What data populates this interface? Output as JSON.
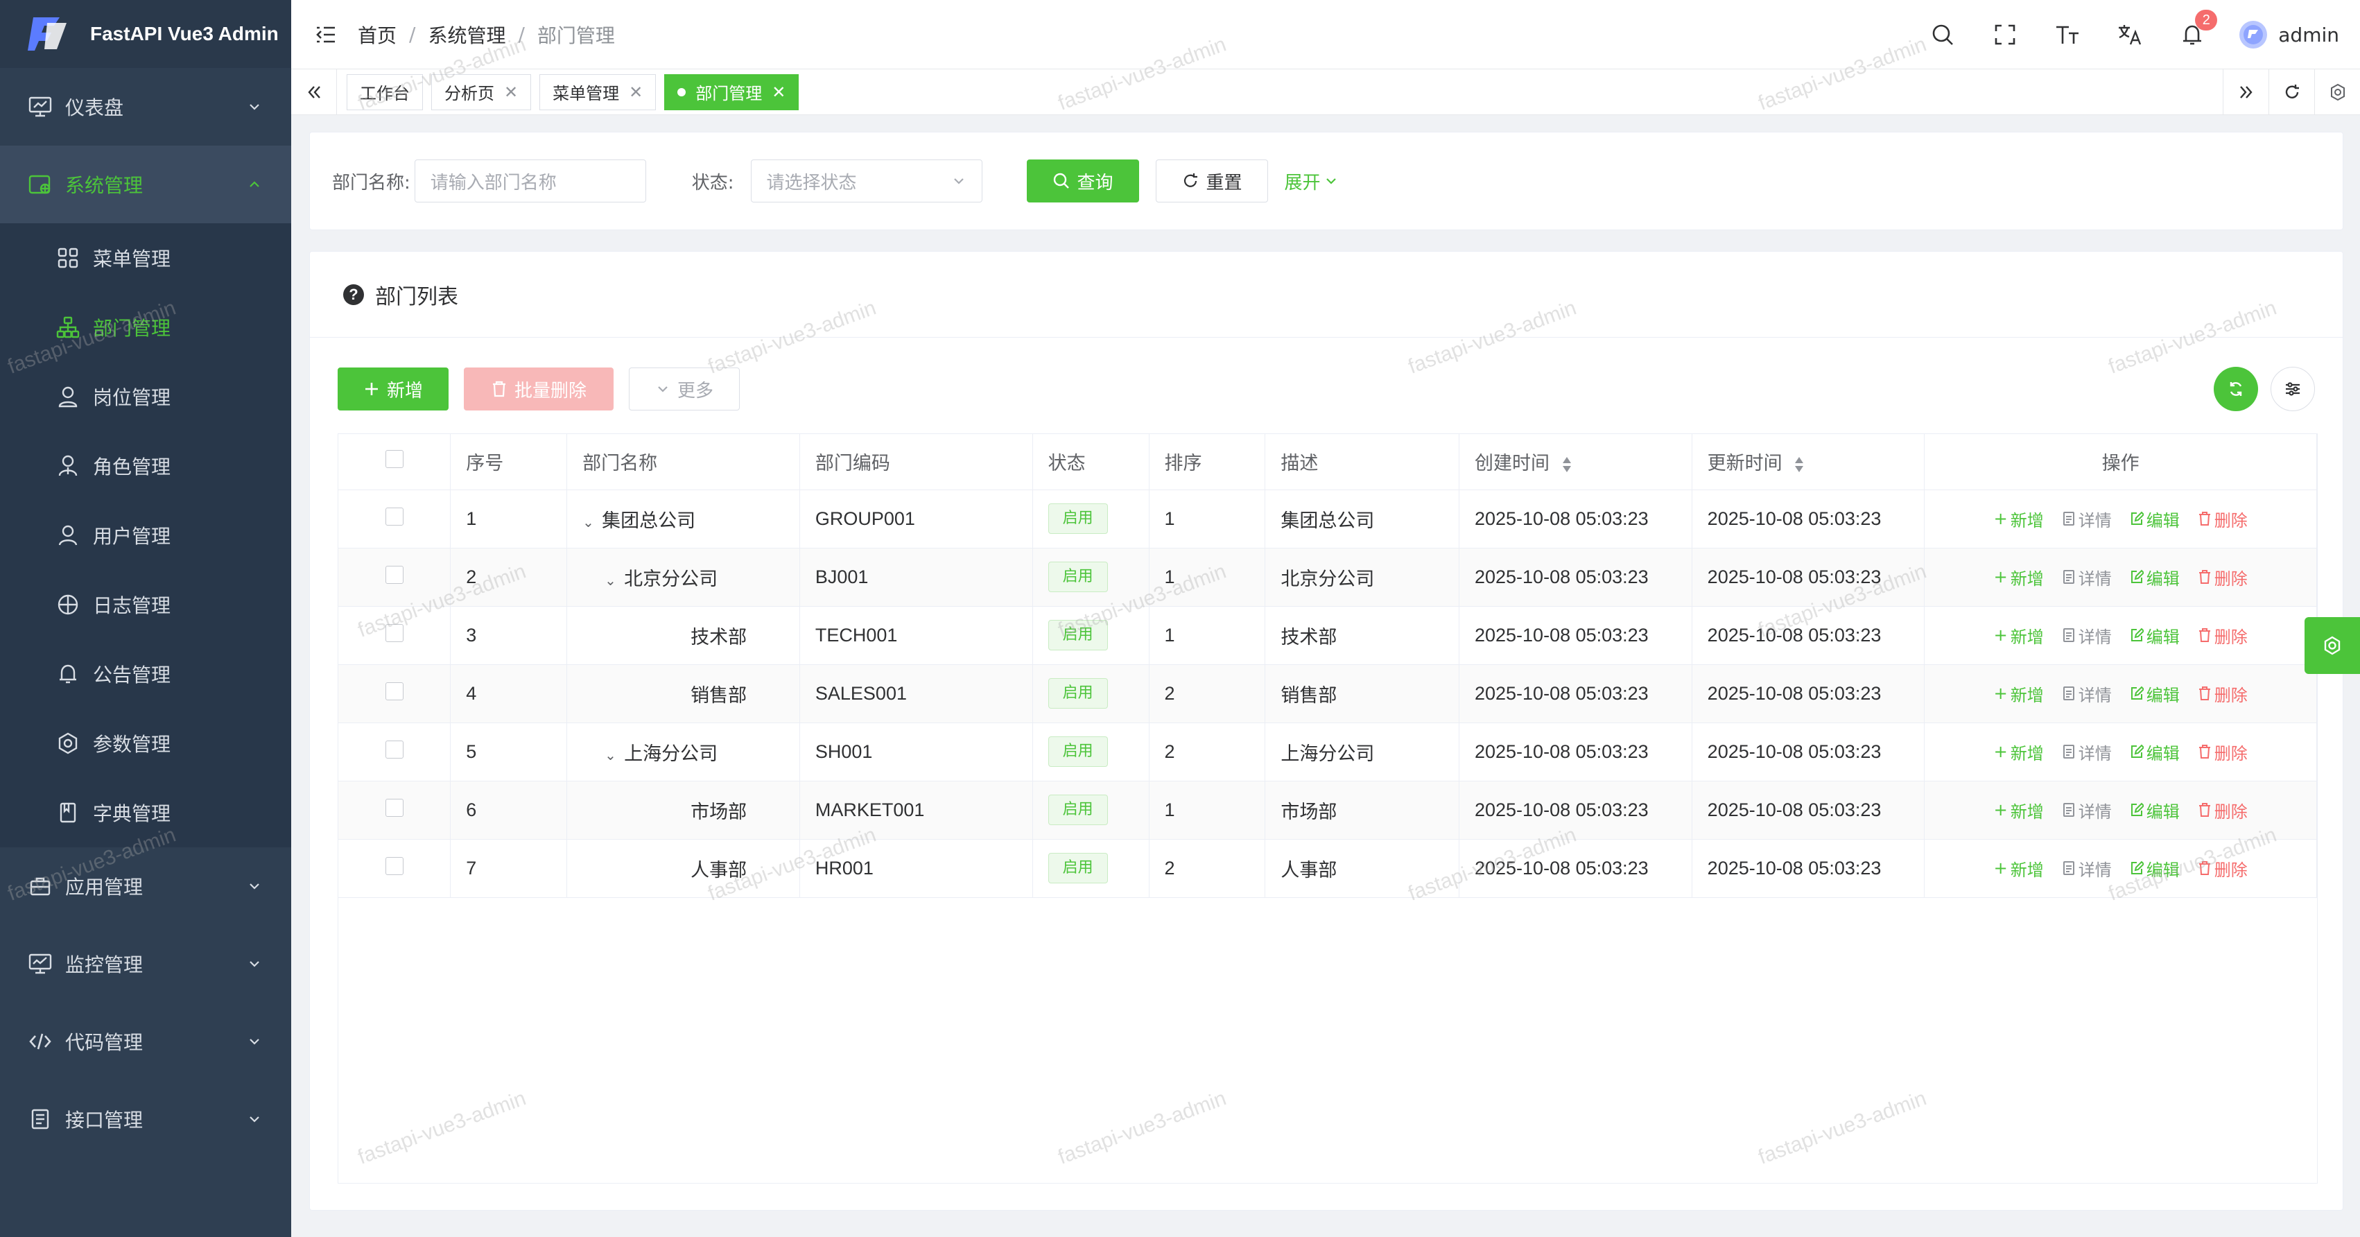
{
  "app": {
    "title": "FastAPI Vue3 Admin"
  },
  "colors": {
    "primary": "#4cc43a",
    "sidebar": "#2f3f52",
    "danger": "#f56c6c"
  },
  "sidebar": {
    "groups": [
      {
        "label": "仪表盘",
        "icon": "dashboard-icon",
        "expanded": false
      },
      {
        "label": "系统管理",
        "icon": "settings-icon",
        "expanded": true
      },
      {
        "label": "应用管理",
        "icon": "briefcase-icon",
        "expanded": false
      },
      {
        "label": "监控管理",
        "icon": "monitor-icon",
        "expanded": false
      },
      {
        "label": "代码管理",
        "icon": "code-icon",
        "expanded": false
      },
      {
        "label": "接口管理",
        "icon": "api-doc-icon",
        "expanded": false
      }
    ],
    "sub_items": [
      {
        "label": "菜单管理",
        "icon": "grid-icon"
      },
      {
        "label": "部门管理",
        "icon": "org-tree-icon"
      },
      {
        "label": "岗位管理",
        "icon": "person-icon"
      },
      {
        "label": "角色管理",
        "icon": "role-icon"
      },
      {
        "label": "用户管理",
        "icon": "user-icon"
      },
      {
        "label": "日志管理",
        "icon": "compass-icon"
      },
      {
        "label": "公告管理",
        "icon": "bell-icon"
      },
      {
        "label": "参数管理",
        "icon": "hexagon-icon"
      },
      {
        "label": "字典管理",
        "icon": "book-icon"
      }
    ]
  },
  "header": {
    "breadcrumb": [
      "首页",
      "系统管理",
      "部门管理"
    ],
    "notification_count": "2",
    "username": "admin"
  },
  "tabs": [
    {
      "label": "工作台",
      "closable": false,
      "active": false
    },
    {
      "label": "分析页",
      "closable": true,
      "active": false
    },
    {
      "label": "菜单管理",
      "closable": true,
      "active": false
    },
    {
      "label": "部门管理",
      "closable": true,
      "active": true
    }
  ],
  "search": {
    "name_label": "部门名称:",
    "name_placeholder": "请输入部门名称",
    "status_label": "状态:",
    "status_placeholder": "请选择状态",
    "query_label": "查询",
    "reset_label": "重置",
    "expand_label": "展开"
  },
  "table": {
    "title": "部门列表",
    "add_label": "新增",
    "batch_delete_label": "批量删除",
    "more_label": "更多",
    "columns": [
      "序号",
      "部门名称",
      "部门编码",
      "状态",
      "排序",
      "描述",
      "创建时间",
      "更新时间",
      "操作"
    ],
    "rows": [
      {
        "index": "1",
        "name": "集团总公司",
        "level": 0,
        "has_children": true,
        "code": "GROUP001",
        "status": "启用",
        "order": "1",
        "desc": "集团总公司",
        "created": "2025-10-08 05:03:23",
        "updated": "2025-10-08 05:03:23"
      },
      {
        "index": "2",
        "name": "北京分公司",
        "level": 1,
        "has_children": true,
        "code": "BJ001",
        "status": "启用",
        "order": "1",
        "desc": "北京分公司",
        "created": "2025-10-08 05:03:23",
        "updated": "2025-10-08 05:03:23"
      },
      {
        "index": "3",
        "name": "技术部",
        "level": 2,
        "has_children": false,
        "code": "TECH001",
        "status": "启用",
        "order": "1",
        "desc": "技术部",
        "created": "2025-10-08 05:03:23",
        "updated": "2025-10-08 05:03:23"
      },
      {
        "index": "4",
        "name": "销售部",
        "level": 2,
        "has_children": false,
        "code": "SALES001",
        "status": "启用",
        "order": "2",
        "desc": "销售部",
        "created": "2025-10-08 05:03:23",
        "updated": "2025-10-08 05:03:23"
      },
      {
        "index": "5",
        "name": "上海分公司",
        "level": 1,
        "has_children": true,
        "code": "SH001",
        "status": "启用",
        "order": "2",
        "desc": "上海分公司",
        "created": "2025-10-08 05:03:23",
        "updated": "2025-10-08 05:03:23"
      },
      {
        "index": "6",
        "name": "市场部",
        "level": 2,
        "has_children": false,
        "code": "MARKET001",
        "status": "启用",
        "order": "1",
        "desc": "市场部",
        "created": "2025-10-08 05:03:23",
        "updated": "2025-10-08 05:03:23"
      },
      {
        "index": "7",
        "name": "人事部",
        "level": 2,
        "has_children": false,
        "code": "HR001",
        "status": "启用",
        "order": "2",
        "desc": "人事部",
        "created": "2025-10-08 05:03:23",
        "updated": "2025-10-08 05:03:23"
      }
    ],
    "ops": {
      "add": "新增",
      "detail": "详情",
      "edit": "编辑",
      "delete": "删除"
    }
  },
  "watermark": "fastapi-vue3-admin"
}
